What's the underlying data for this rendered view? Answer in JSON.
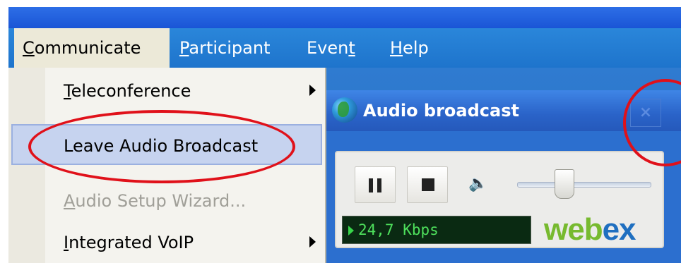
{
  "menubar": {
    "items": [
      {
        "label_ul": "C",
        "label_rest": "ommunicate"
      },
      {
        "label_ul": "P",
        "label_rest": "articipant"
      },
      {
        "label_pre": "Even",
        "label_ul": "t",
        "label_rest": ""
      },
      {
        "label_ul": "H",
        "label_rest": "elp"
      }
    ]
  },
  "dropdown": {
    "items": [
      {
        "label_ul": "T",
        "label_rest": "eleconference",
        "has_submenu": true
      },
      {
        "label": "Leave Audio Broadcast",
        "highlighted": true
      },
      {
        "label_ul": "A",
        "label_rest": "udio Setup Wizard...",
        "disabled": true
      },
      {
        "label_ul": "I",
        "label_rest": "ntegrated VoIP",
        "has_submenu": true
      }
    ]
  },
  "audio_window": {
    "title": "Audio broadcast",
    "close_symbol": "×",
    "bitrate": "24,7 Kbps",
    "speaker_symbol": "🔈",
    "volume_level": 0.35,
    "logo_web": "web",
    "logo_ex": "ex"
  },
  "colors": {
    "menubar": "#1e74cc",
    "title_bar": "#2a63c8",
    "highlight": "#c6d3ef",
    "annotation_red": "#e0111a",
    "kbps_green": "#4ee05c"
  }
}
